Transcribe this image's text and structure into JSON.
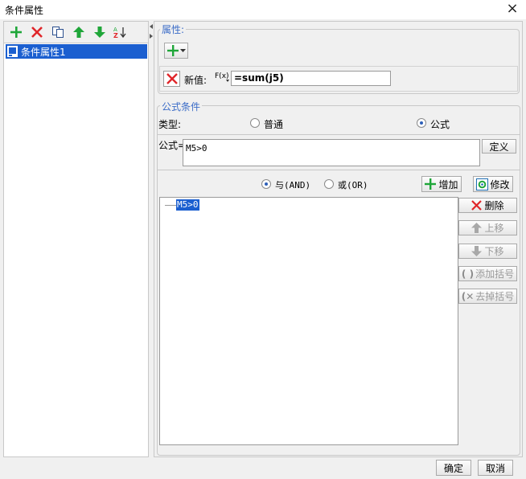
{
  "window": {
    "title": "条件属性",
    "close_icon": "×"
  },
  "left": {
    "toolbar": {
      "add": "add-icon",
      "delete": "delete-icon",
      "copy": "copy-icon",
      "up": "move-up-icon",
      "down": "move-down-icon",
      "sort": "sort-az-icon"
    },
    "tree": {
      "items": [
        {
          "label": "条件属性1",
          "selected": true
        }
      ]
    }
  },
  "right": {
    "attributes": {
      "legend": "属性:",
      "new_value_label": "新值:",
      "fx_label": "F(x)",
      "new_value": "=sum(j5)"
    },
    "formula_condition": {
      "legend": "公式条件",
      "type_label": "类型:",
      "type_options": [
        "普通",
        "公式"
      ],
      "selected_type": "公式",
      "formula_label": "公式=",
      "formula_value": "M5>0",
      "define_button": "定义",
      "logic_options": [
        "与(AND)",
        "或(OR)"
      ],
      "selected_logic": "与(AND)",
      "add_button": "增加",
      "modify_button": "修改",
      "condition_list": [
        "M5>0"
      ],
      "side_buttons": {
        "delete": "删除",
        "move_up": "上移",
        "move_down": "下移",
        "add_bracket": "添加括号",
        "remove_bracket": "去掉括号"
      }
    }
  },
  "footer": {
    "ok": "确定",
    "cancel": "取消"
  },
  "colors": {
    "accent": "#3b6cc7",
    "green": "#1fa639",
    "red": "#e0262a",
    "selection": "#1b5fd0"
  }
}
